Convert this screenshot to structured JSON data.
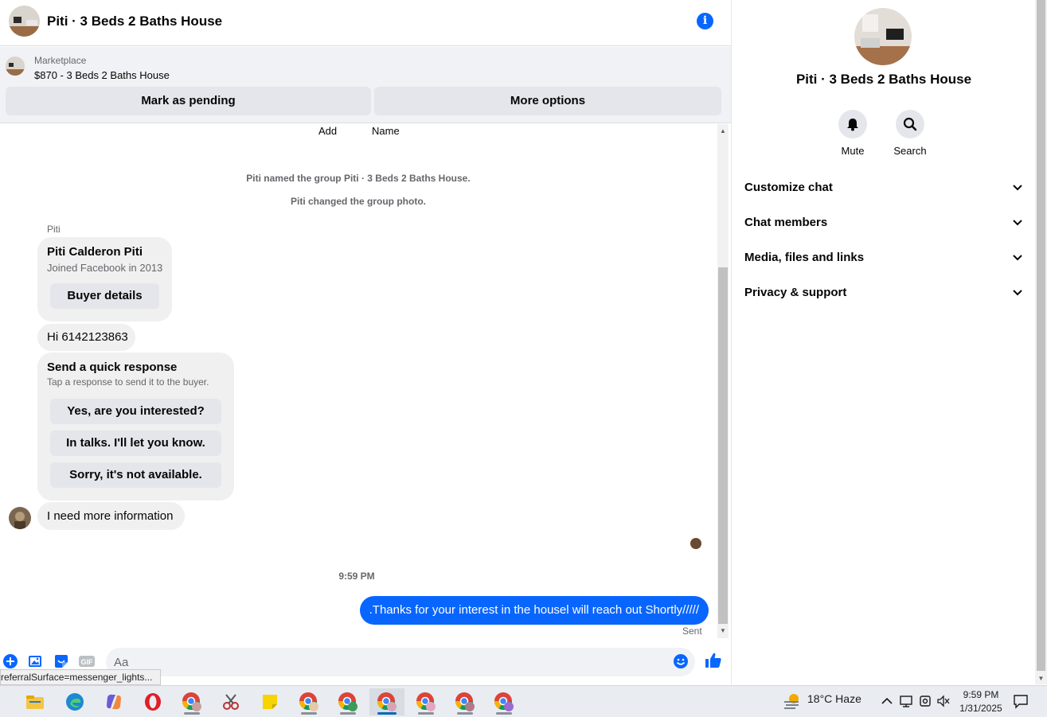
{
  "header": {
    "title": "Piti · 3 Beds 2 Baths House",
    "info_glyph": "i"
  },
  "marketplace": {
    "label": "Marketplace",
    "item": "$870 - 3 Beds 2 Baths House",
    "pending_button": "Mark as pending",
    "more_button": "More options"
  },
  "thread": {
    "top_actions": [
      "Add",
      "Name"
    ],
    "system_messages": [
      "Piti named the group Piti · 3 Beds 2 Baths House.",
      "Piti changed the group photo."
    ],
    "sender_name": "Piti",
    "buyer_card": {
      "name": "Piti Calderon Piti",
      "joined": "Joined Facebook in 2013",
      "button": "Buyer details"
    },
    "greeting": "Hi 6142123863",
    "quick_response": {
      "title": "Send a quick response",
      "subtitle": "Tap a response to send it to the buyer.",
      "options": [
        "Yes, are you interested?",
        "In talks. I'll let you know.",
        "Sorry, it's not available."
      ]
    },
    "incoming_message": "I need more information",
    "time_separator": "9:59 PM",
    "outgoing_message": ".Thanks for your interest in the housel will reach out Shortly/////",
    "sent_status": "Sent"
  },
  "composer": {
    "placeholder": "Aa",
    "gif_label": "GIF",
    "tooltip_url": "referralSurface=messenger_lights..."
  },
  "details_pane": {
    "title": "Piti · 3 Beds 2 Baths House",
    "actions": [
      {
        "label": "Mute",
        "icon": "bell-icon"
      },
      {
        "label": "Search",
        "icon": "search-icon"
      }
    ],
    "sections": [
      "Customize chat",
      "Chat members",
      "Media, files and links",
      "Privacy & support"
    ]
  },
  "taskbar": {
    "weather": "18°C  Haze",
    "time": "9:59 PM",
    "date": "1/31/2025"
  },
  "colors": {
    "accent": "#0866ff",
    "bubble_gray": "#f0f0f0",
    "panel_gray": "#f0f2f5"
  }
}
